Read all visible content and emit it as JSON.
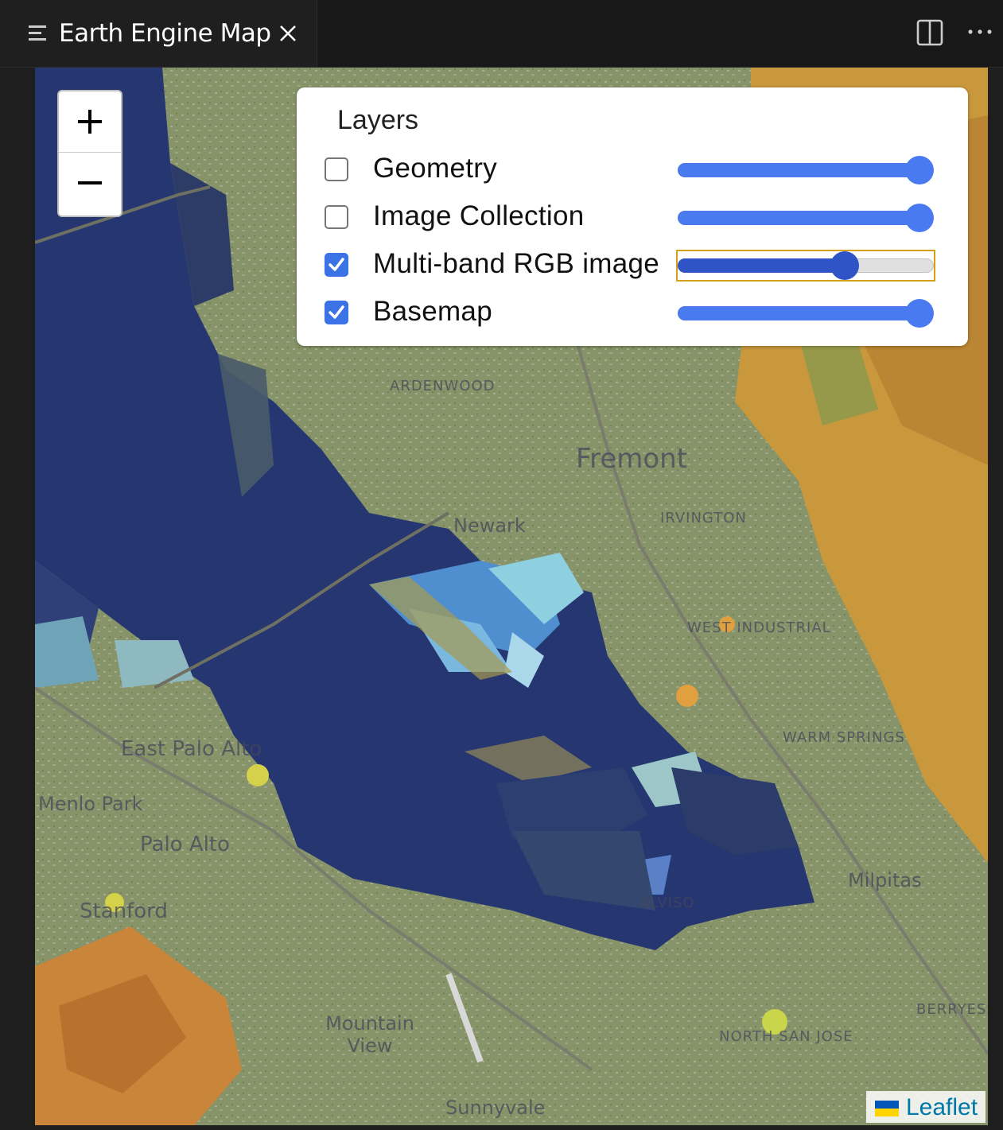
{
  "tab": {
    "title": "Earth Engine Map",
    "icon": "lines-icon",
    "close_icon": "close-icon"
  },
  "toolbar": {
    "split_icon": "split-editor-icon",
    "more_icon": "more-actions-icon"
  },
  "zoom": {
    "in_label": "+",
    "out_label": "−"
  },
  "layers": {
    "title": "Layers",
    "items": [
      {
        "label": "Geometry",
        "checked": false,
        "opacity": 1.0,
        "focused": false
      },
      {
        "label": "Image Collection",
        "checked": false,
        "opacity": 1.0,
        "focused": false
      },
      {
        "label": "Multi-band RGB image",
        "checked": true,
        "opacity": 0.67,
        "focused": true
      },
      {
        "label": "Basemap",
        "checked": true,
        "opacity": 1.0,
        "focused": false
      }
    ]
  },
  "map": {
    "places": [
      "ARDENWOOD",
      "Fremont",
      "Newark",
      "IRVINGTON",
      "East Palo Alto",
      "Palo Alto",
      "Stanford",
      "Mountain View",
      "Sunnyvale",
      "ALVISO",
      "Milpitas",
      "NORTH SAN JOSE",
      "BERRYESSA",
      "WARM SPRINGS",
      "WEST INDUSTRIAL",
      "Menlo Park"
    ]
  },
  "attribution": {
    "link": "Leaflet",
    "flag_icon": "ukraine-flag-icon"
  },
  "colors": {
    "accent": "#4a7af0",
    "accent_dark": "#2f54c5",
    "focus_outline": "#d4a017",
    "checkbox_checked": "#3b73e6",
    "tab_bg": "#1f1f1f",
    "water": "#25346b"
  }
}
